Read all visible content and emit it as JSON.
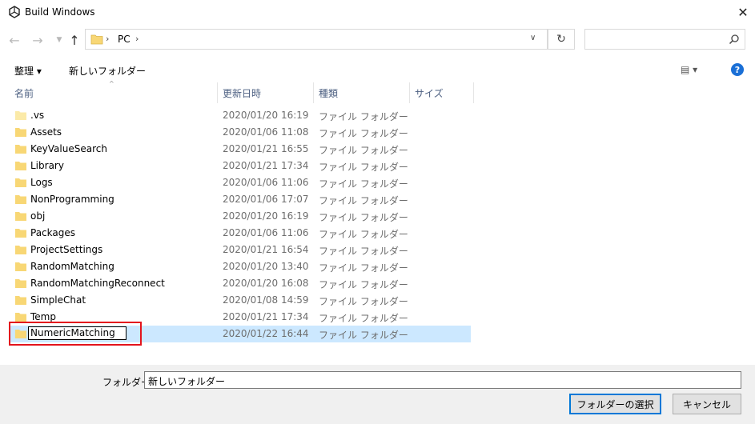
{
  "window": {
    "title": "Build Windows"
  },
  "address": {
    "location": "PC"
  },
  "search": {
    "placeholder": ""
  },
  "toolbar": {
    "organize_label": "整理 ▾",
    "new_folder_label": "新しいフォルダー"
  },
  "columns": {
    "name": "名前",
    "date": "更新日時",
    "type": "種類",
    "size": "サイズ"
  },
  "files": [
    {
      "name": ".vs",
      "date": "2020/01/20 16:19",
      "type": "ファイル フォルダー"
    },
    {
      "name": "Assets",
      "date": "2020/01/06 11:08",
      "type": "ファイル フォルダー"
    },
    {
      "name": "KeyValueSearch",
      "date": "2020/01/21 16:55",
      "type": "ファイル フォルダー"
    },
    {
      "name": "Library",
      "date": "2020/01/21 17:34",
      "type": "ファイル フォルダー"
    },
    {
      "name": "Logs",
      "date": "2020/01/06 11:06",
      "type": "ファイル フォルダー"
    },
    {
      "name": "NonProgramming",
      "date": "2020/01/06 17:07",
      "type": "ファイル フォルダー"
    },
    {
      "name": "obj",
      "date": "2020/01/20 16:19",
      "type": "ファイル フォルダー"
    },
    {
      "name": "Packages",
      "date": "2020/01/06 11:06",
      "type": "ファイル フォルダー"
    },
    {
      "name": "ProjectSettings",
      "date": "2020/01/21 16:54",
      "type": "ファイル フォルダー"
    },
    {
      "name": "RandomMatching",
      "date": "2020/01/20 13:40",
      "type": "ファイル フォルダー"
    },
    {
      "name": "RandomMatchingReconnect",
      "date": "2020/01/20 16:08",
      "type": "ファイル フォルダー"
    },
    {
      "name": "SimpleChat",
      "date": "2020/01/08 14:59",
      "type": "ファイル フォルダー"
    },
    {
      "name": "Temp",
      "date": "2020/01/21 17:34",
      "type": "ファイル フォルダー"
    },
    {
      "name": "NumericMatching",
      "date": "2020/01/22 16:44",
      "type": "ファイル フォルダー"
    }
  ],
  "footer": {
    "folder_label": "フォルダー:",
    "folder_value": "新しいフォルダー",
    "select_button": "フォルダーの選択",
    "cancel_button": "キャンセル"
  },
  "colors": {
    "selected_row": "#cce8ff",
    "highlight": "#e3141d",
    "folder": "#f8d775"
  }
}
